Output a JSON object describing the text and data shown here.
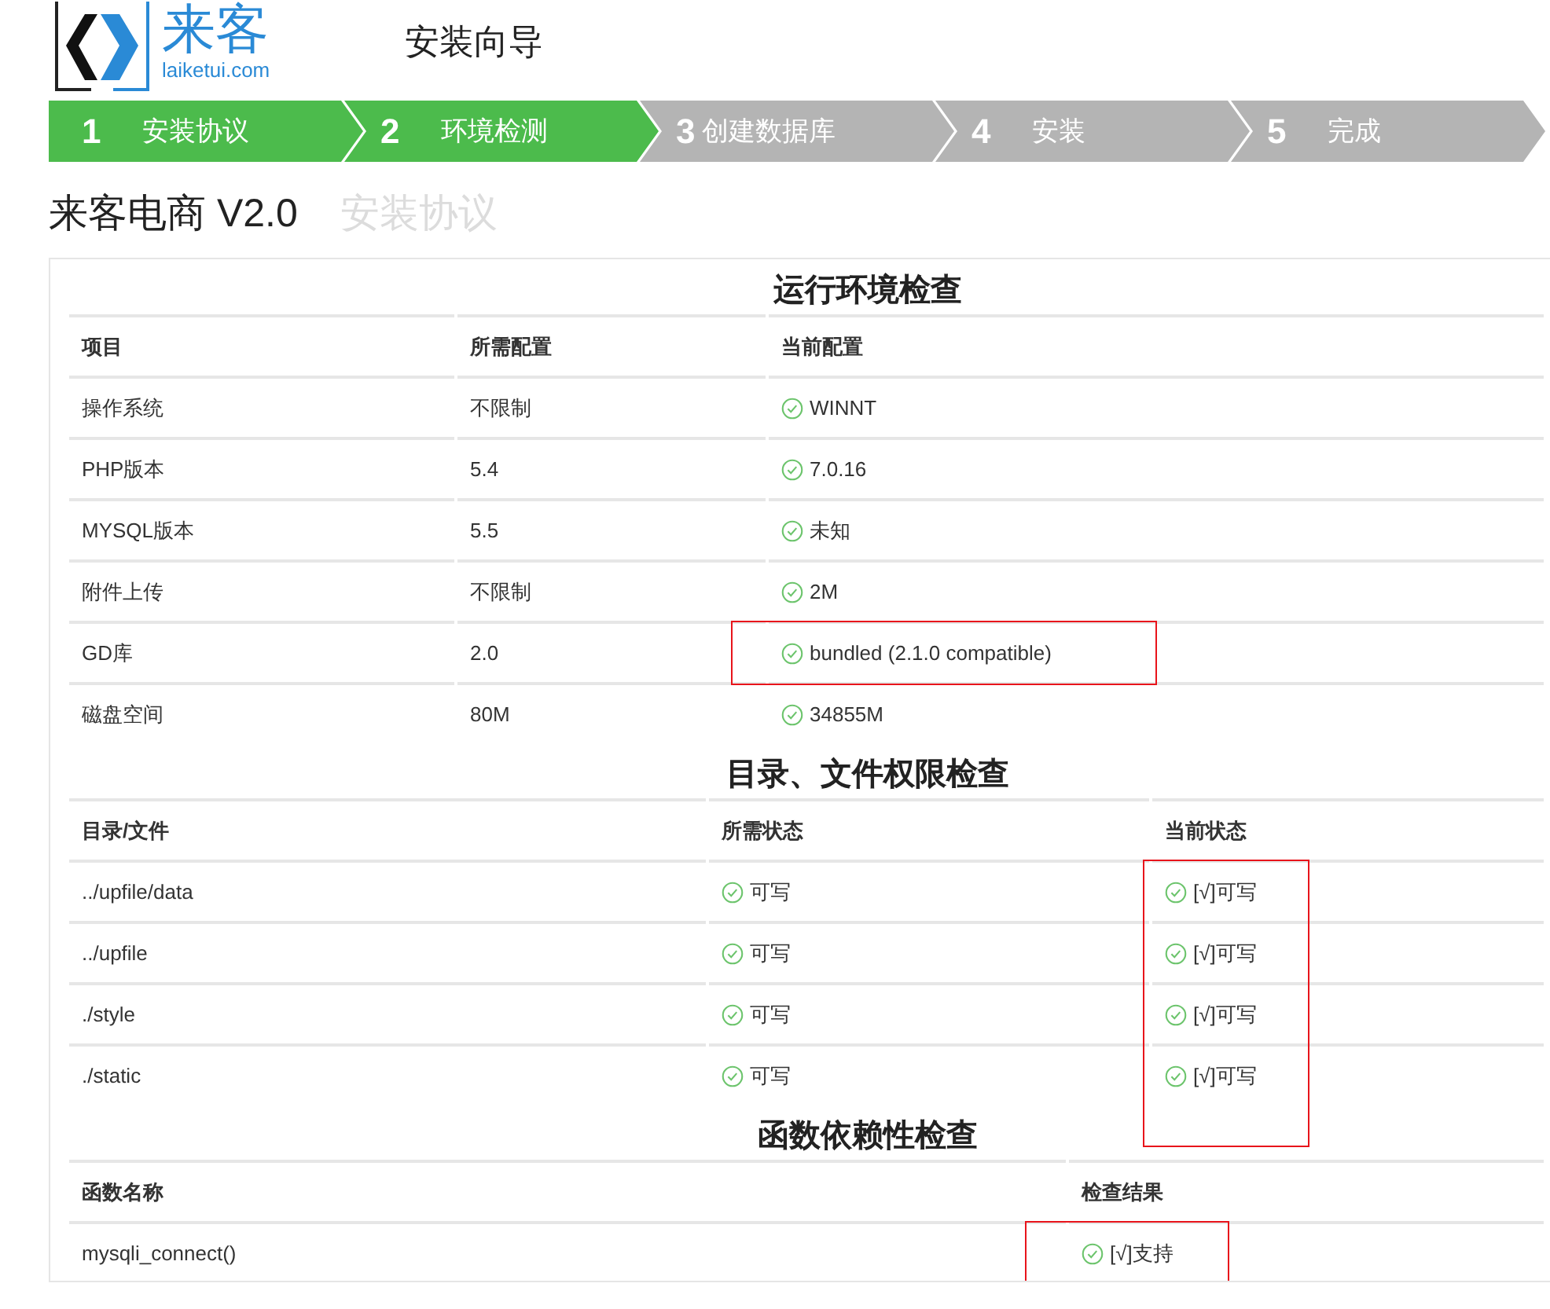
{
  "logo": {
    "mark": "来客",
    "domain": "laiketui.com"
  },
  "page_title": "安装向导",
  "steps": [
    {
      "number": "1",
      "label": "安装协议",
      "done": true
    },
    {
      "number": "2",
      "label": "环境检测",
      "done": true
    },
    {
      "number": "3",
      "label": "创建数据库",
      "done": false
    },
    {
      "number": "4",
      "label": "安装",
      "done": false
    },
    {
      "number": "5",
      "label": "完成",
      "done": false
    }
  ],
  "heading": {
    "product": "来客电商 V2.0",
    "subtitle": "安装协议"
  },
  "sections": [
    {
      "title": "运行环境检查",
      "columns": [
        "项目",
        "所需配置",
        "当前配置"
      ],
      "rows": [
        {
          "cells": [
            {
              "text": "操作系统",
              "ok": false
            },
            {
              "text": "不限制",
              "ok": false
            },
            {
              "text": "WINNT",
              "ok": true
            }
          ],
          "highlighted": false
        },
        {
          "cells": [
            {
              "text": "PHP版本",
              "ok": false
            },
            {
              "text": "5.4",
              "ok": false
            },
            {
              "text": "7.0.16",
              "ok": true
            }
          ],
          "highlighted": false
        },
        {
          "cells": [
            {
              "text": "MYSQL版本",
              "ok": false
            },
            {
              "text": "5.5",
              "ok": false
            },
            {
              "text": "未知",
              "ok": true
            }
          ],
          "highlighted": false
        },
        {
          "cells": [
            {
              "text": "附件上传",
              "ok": false
            },
            {
              "text": "不限制",
              "ok": false
            },
            {
              "text": "2M",
              "ok": true
            }
          ],
          "highlighted": false
        },
        {
          "cells": [
            {
              "text": "GD库",
              "ok": false
            },
            {
              "text": "2.0",
              "ok": false
            },
            {
              "text": "bundled (2.1.0 compatible)",
              "ok": true
            }
          ],
          "highlighted": true
        },
        {
          "cells": [
            {
              "text": "磁盘空间",
              "ok": false
            },
            {
              "text": "80M",
              "ok": false
            },
            {
              "text": "34855M",
              "ok": true
            }
          ],
          "highlighted": false
        }
      ]
    },
    {
      "title": "目录、文件权限检查",
      "columns": [
        "目录/文件",
        "所需状态",
        "当前状态"
      ],
      "rows": [
        {
          "cells": [
            {
              "text": "../upfile/data",
              "ok": false
            },
            {
              "text": "可写",
              "ok": true
            },
            {
              "text": "[√]可写",
              "ok": true
            }
          ],
          "highlighted": true
        },
        {
          "cells": [
            {
              "text": "../upfile",
              "ok": false
            },
            {
              "text": "可写",
              "ok": true
            },
            {
              "text": "[√]可写",
              "ok": true
            }
          ],
          "highlighted": true
        },
        {
          "cells": [
            {
              "text": "./style",
              "ok": false
            },
            {
              "text": "可写",
              "ok": true
            },
            {
              "text": "[√]可写",
              "ok": true
            }
          ],
          "highlighted": true
        },
        {
          "cells": [
            {
              "text": "./static",
              "ok": false
            },
            {
              "text": "可写",
              "ok": true
            },
            {
              "text": "[√]可写",
              "ok": true
            }
          ],
          "highlighted": true
        }
      ]
    },
    {
      "title": "函数依赖性检查",
      "columns": [
        "函数名称",
        "检查结果"
      ],
      "rows": [
        {
          "cells": [
            {
              "text": "mysqli_connect()",
              "ok": false
            },
            {
              "text": "[√]支持",
              "ok": true
            }
          ],
          "highlighted": true
        }
      ]
    }
  ]
}
